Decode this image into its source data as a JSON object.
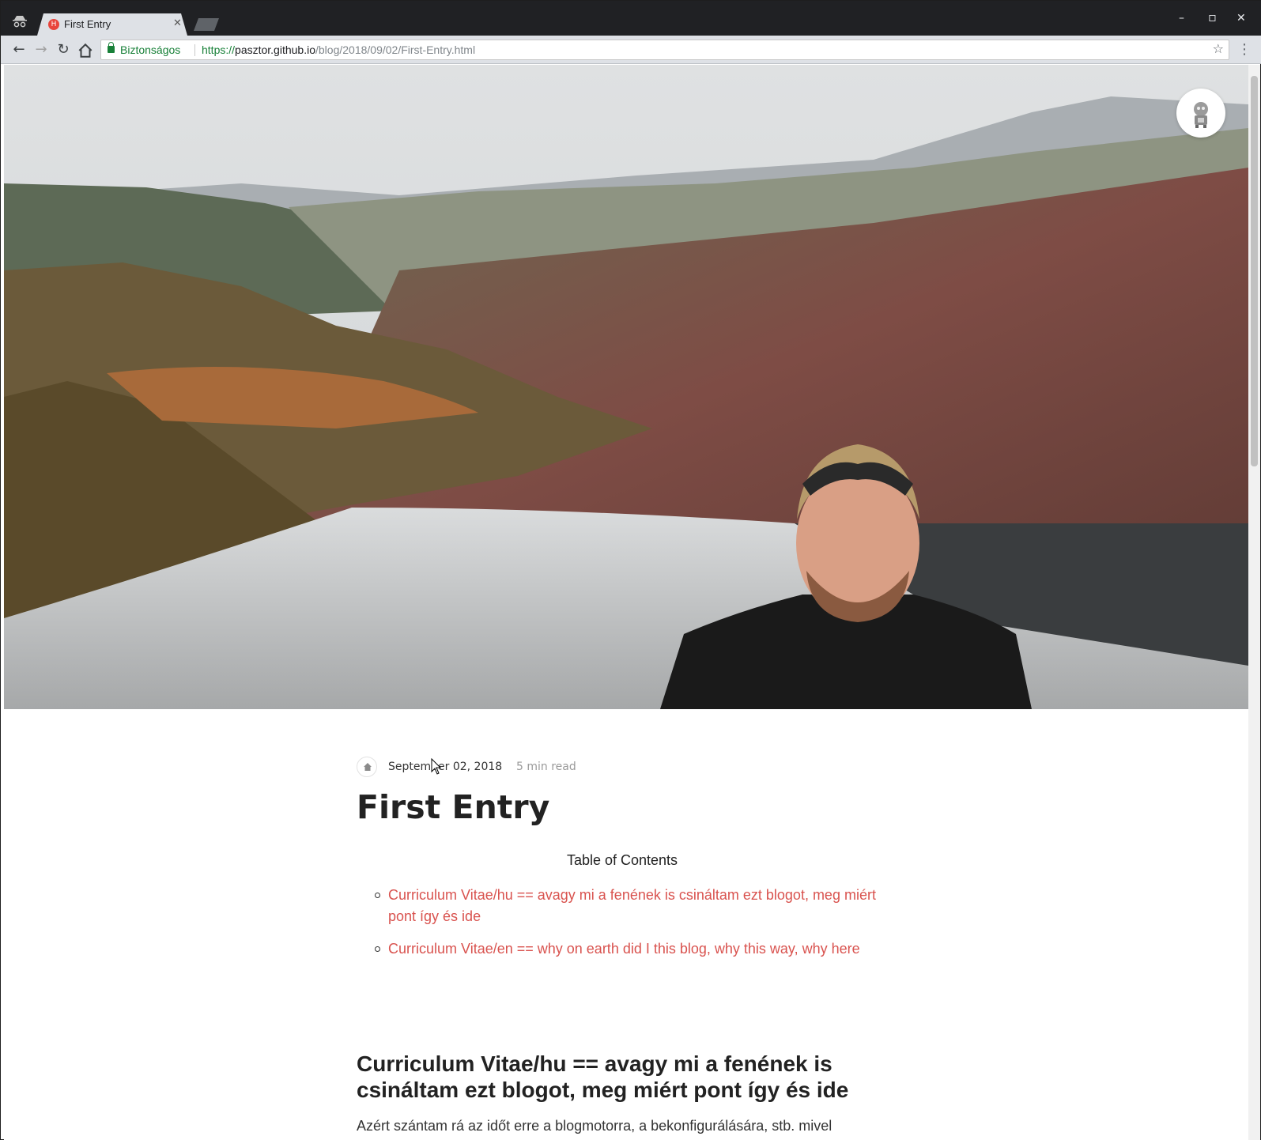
{
  "browser": {
    "tab_title": "First Entry",
    "tab_favicon_letter": "H",
    "security_label": "Biztonságos",
    "url_scheme": "https://",
    "url_host": "pasztor.github.io",
    "url_path": "/blog/2018/09/02/First-Entry.html",
    "icons": {
      "back": "arrow-back-icon",
      "forward": "arrow-forward-icon",
      "reload": "reload-icon",
      "home": "home-icon",
      "bookmark": "star-icon",
      "menu": "kebab-menu-icon",
      "incognito": "incognito-icon"
    },
    "window_controls": {
      "minimize": "–",
      "maximize": "▫",
      "close": "✕"
    }
  },
  "post": {
    "date": "September 02, 2018",
    "read_time": "5 min read",
    "title": "First Entry",
    "toc_heading": "Table of Contents",
    "toc": [
      {
        "label": "Curriculum Vitae/hu == avagy mi a fenének is csináltam ezt blogot, meg miért pont így és ide"
      },
      {
        "label": "Curriculum Vitae/en == why on earth did I this blog, why this way, why here"
      }
    ],
    "section_title": "Curriculum Vitae/hu == avagy mi a fenének is csináltam ezt blogot, meg miért pont így és ide",
    "body": "Azért szántam rá az időt erre a blogmotorra, a bekonfigurálására, stb. mivel szerettem volna egy felhőszolgáltatótól független módszert arra, hogy közzétegyem, amit közzé szeretnék tenni. Ha valaki ismeri a git működését, az tudja, hogy ez"
  },
  "colors": {
    "link": "#d9534f",
    "secure": "#188038",
    "tabstrip": "#202124",
    "toolbar": "#dee1e6"
  }
}
